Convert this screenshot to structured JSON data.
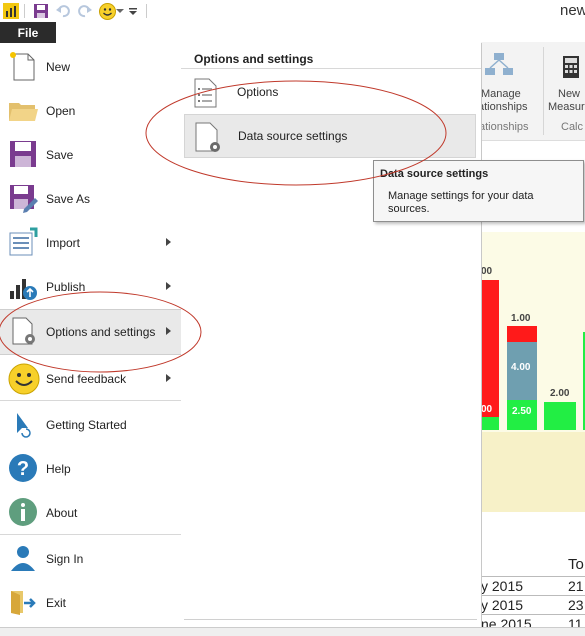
{
  "window": {
    "title": "new"
  },
  "quick_access": {
    "icons": [
      "power-bi-logo-icon",
      "save-icon",
      "undo-icon",
      "redo-icon",
      "smiley-icon",
      "dropdown-icon",
      "customize-icon"
    ]
  },
  "file_tab": {
    "label": "File"
  },
  "menu": {
    "items": [
      {
        "id": "new",
        "label": "New"
      },
      {
        "id": "open",
        "label": "Open"
      },
      {
        "id": "save",
        "label": "Save"
      },
      {
        "id": "save-as",
        "label": "Save As"
      },
      {
        "id": "import",
        "label": "Import"
      },
      {
        "id": "publish",
        "label": "Publish"
      },
      {
        "id": "options",
        "label": "Options and settings"
      },
      {
        "id": "feedback",
        "label": "Send feedback"
      },
      {
        "id": "getting-started",
        "label": "Getting Started"
      },
      {
        "id": "help",
        "label": "Help"
      },
      {
        "id": "about",
        "label": "About"
      },
      {
        "id": "sign-in",
        "label": "Sign In"
      },
      {
        "id": "exit",
        "label": "Exit"
      }
    ]
  },
  "submenu": {
    "title": "Options and settings",
    "items": [
      {
        "label": "Options"
      },
      {
        "label": "Data source settings"
      }
    ]
  },
  "tooltip": {
    "title": "Data source settings",
    "body": "Manage settings for your data sources."
  },
  "background": {
    "ribbon": {
      "manage_line1": "Manage",
      "manage_line2": "ationships",
      "group_label": "ationships",
      "new_line1": "New",
      "new_line2": "Measur",
      "calc_label": "Calc"
    },
    "chart_labels": [
      "00",
      "1.00",
      "4.00",
      "2.00",
      "00",
      "2.50"
    ],
    "table": {
      "header_right": "To",
      "rows": [
        {
          "left": "y 2015",
          "right": "21"
        },
        {
          "left": "y 2015",
          "right": "23"
        },
        {
          "left": "ne 2015",
          "right": "11"
        }
      ]
    }
  }
}
